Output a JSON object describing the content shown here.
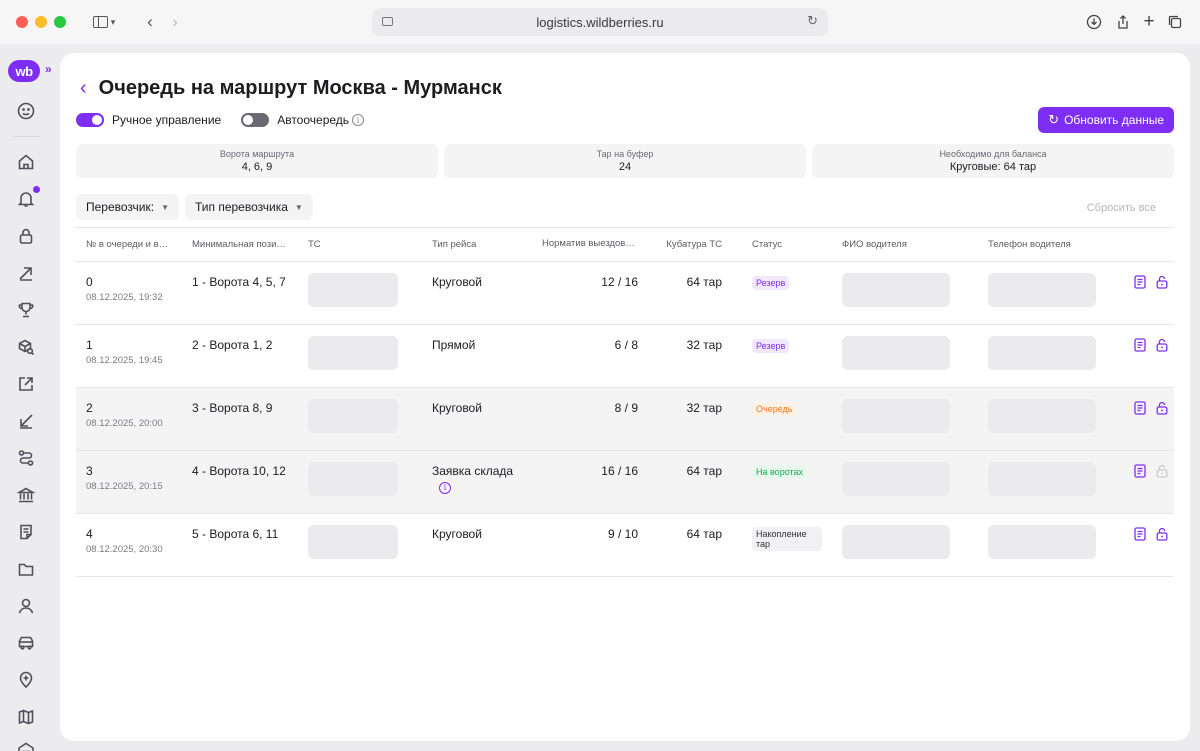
{
  "browser": {
    "url": "logistics.wildberries.ru"
  },
  "sidebar": {
    "logo": "wb",
    "items": [
      {
        "icon": "account-circle-icon"
      },
      {
        "icon": "home-icon"
      },
      {
        "icon": "bell-icon"
      },
      {
        "icon": "lock-icon"
      },
      {
        "icon": "arrow-up-right-icon"
      },
      {
        "icon": "trophy-icon"
      },
      {
        "icon": "box-search-icon"
      },
      {
        "icon": "external-box-icon"
      },
      {
        "icon": "arrow-down-left-icon"
      },
      {
        "icon": "route-icon"
      },
      {
        "icon": "bank-icon"
      },
      {
        "icon": "document-icon"
      },
      {
        "icon": "folder-icon"
      },
      {
        "icon": "user-icon"
      },
      {
        "icon": "truck-icon"
      },
      {
        "icon": "location-plus-icon"
      },
      {
        "icon": "map-icon"
      },
      {
        "icon": "warehouse-icon"
      }
    ]
  },
  "header": {
    "title": "Очередь на маршрут Москва - Мурманск",
    "manual_label": "Ручное управление",
    "auto_label": "Автоочередь",
    "refresh_label": "Обновить данные"
  },
  "stats": [
    {
      "label": "Ворота маршрута",
      "value": "4, 6, 9"
    },
    {
      "label": "Тар на буфер",
      "value": "24"
    },
    {
      "label": "Необходимо для баланса",
      "value": "Круговые: 64 тар"
    }
  ],
  "filters": {
    "carrier": "Перевозчик:",
    "carrier_type": "Тип перевозчика",
    "reset": "Сбросить все"
  },
  "table": {
    "headers": [
      "№ в очереди и время",
      "Минимальная позиция",
      "ТС",
      "Тип рейса",
      "Норматив выездов",
      "Кубатура ТС",
      "Статус",
      "ФИО водителя",
      "Телефон водителя"
    ],
    "rows": [
      {
        "num": "0",
        "date": "08.12.2025, 19:32",
        "pos": "1 - Ворота 4, 5, 7",
        "type": "Круговой",
        "norm": "12 / 16",
        "volume": "64 тар",
        "status": "Резерв",
        "status_kind": "reserve"
      },
      {
        "num": "1",
        "date": "08.12.2025, 19:45",
        "pos": "2 - Ворота 1, 2",
        "type": "Прямой",
        "norm": "6 / 8",
        "volume": "32 тар",
        "status": "Резерв",
        "status_kind": "reserve"
      },
      {
        "num": "2",
        "date": "08.12.2025, 20:00",
        "pos": "3 - Ворота 8, 9",
        "type": "Круговой",
        "norm": "8 / 9",
        "volume": "32 тар",
        "status": "Очередь",
        "status_kind": "queue"
      },
      {
        "num": "3",
        "date": "08.12.2025, 20:15",
        "pos": "4 - Ворота 10, 12",
        "type": "Заявка склада",
        "norm": "16 / 16",
        "volume": "64 тар",
        "status": "На воротах",
        "status_kind": "gate"
      },
      {
        "num": "4",
        "date": "08.12.2025, 20:30",
        "pos": "5 - Ворота 6, 11",
        "type": "Круговой",
        "norm": "9 / 10",
        "volume": "64 тар",
        "status": "Накопление тар",
        "status_kind": "accum"
      }
    ]
  },
  "colors": {
    "accent": "#7d2ef2",
    "reserve": "#7d2ef2",
    "queue": "#f47a1f",
    "gate": "#1ea653"
  }
}
